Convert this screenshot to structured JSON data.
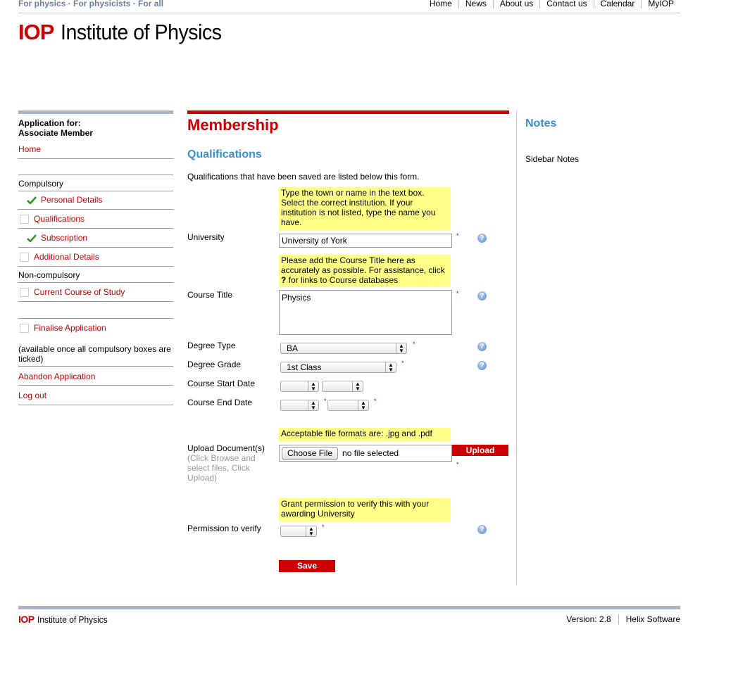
{
  "header": {
    "tagline": "For physics · For physicists · For all",
    "nav": [
      "Home",
      "News",
      "About us",
      "Contact us",
      "Calendar",
      "MyIOP"
    ],
    "logo_mark": "IOP",
    "logo_text": "Institute of Physics"
  },
  "sidebar": {
    "heading_line1": "Application for:",
    "heading_line2": "Associate Member",
    "home": "Home",
    "compulsory": "Compulsory",
    "items": [
      {
        "label": "Personal Details",
        "status": "done"
      },
      {
        "label": "Qualifications",
        "status": "empty"
      },
      {
        "label": "Subscription",
        "status": "done"
      },
      {
        "label": "Additional Details",
        "status": "empty"
      }
    ],
    "non_compulsory": "Non-compulsory",
    "course_item": "Current Course of Study",
    "finalise": "Finalise Application",
    "finalise_note": "(available once all compulsory boxes are ticked)",
    "abandon": "Abandon Application",
    "logout": "Log out"
  },
  "main": {
    "title": "Membership",
    "section": "Qualifications",
    "intro": "Qualifications that have been saved are listed below this form.",
    "university": {
      "hint": "Type the town or name in the text box. Select the correct institution. If your institution is not listed, type the name you have.",
      "label": "University",
      "value": "University of York"
    },
    "course_title": {
      "hint_part1": "Please add the Course Title here as accurately as possible. For assistance, click ",
      "hint_bold": "?",
      "hint_part2": " for links to Course databases",
      "label": "Course Title",
      "value": "Physics"
    },
    "degree_type": {
      "label": "Degree Type",
      "value": "BA"
    },
    "degree_grade": {
      "label": "Degree Grade",
      "value": "1st Class"
    },
    "start_date": {
      "label": "Course Start Date"
    },
    "end_date": {
      "label": "Course End Date"
    },
    "upload": {
      "hint": "Acceptable file formats are: .jpg and .pdf",
      "label": "Upload Document(s)",
      "sublabel": "(Click Browse and select files, Click Upload)",
      "choose_btn": "Choose File",
      "file_status": "no file selected",
      "upload_btn": "Upload"
    },
    "permission": {
      "hint": "Grant permission to verify this with your awarding University",
      "label": "Permission to verify"
    },
    "required_mark": "*",
    "help_glyph": "?",
    "save_btn": "Save"
  },
  "notes": {
    "title": "Notes",
    "text": "Sidebar Notes"
  },
  "footer": {
    "logo_mark": "IOP",
    "logo_text": "Institute of Physics",
    "version": "Version: 2.8",
    "vendor": "Helix Software"
  },
  "colors": {
    "brand_red": "#cc0000",
    "heading_blue": "#3a8fd0",
    "hint_yellow": "#ffff88",
    "bar_grey": "#a9b4c9"
  }
}
